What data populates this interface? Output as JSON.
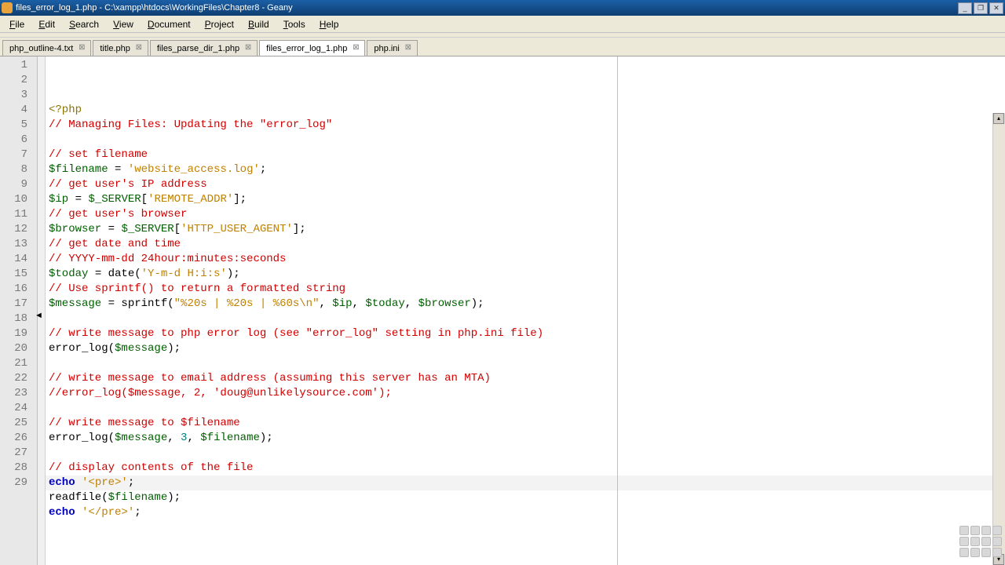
{
  "window": {
    "title": "files_error_log_1.php - C:\\xampp\\htdocs\\WorkingFiles\\Chapter8 - Geany"
  },
  "menu": {
    "file": "File",
    "edit": "Edit",
    "search": "Search",
    "view": "View",
    "document": "Document",
    "project": "Project",
    "build": "Build",
    "tools": "Tools",
    "help": "Help"
  },
  "tabs": [
    {
      "label": "php_outline-4.txt",
      "active": false
    },
    {
      "label": "title.php",
      "active": false
    },
    {
      "label": "files_parse_dir_1.php",
      "active": false
    },
    {
      "label": "files_error_log_1.php",
      "active": true
    },
    {
      "label": "php.ini",
      "active": false
    }
  ],
  "editor": {
    "line_count": 29,
    "current_line": 29,
    "tokens": [
      [
        {
          "t": "<?php",
          "c": "c-preproc"
        }
      ],
      [
        {
          "t": "// Managing Files: Updating the \"error_log\"",
          "c": "c-comment"
        }
      ],
      [],
      [
        {
          "t": "// set filename",
          "c": "c-comment"
        }
      ],
      [
        {
          "t": "$filename",
          "c": "c-var"
        },
        {
          "t": " = ",
          "c": "c-op"
        },
        {
          "t": "'website_access.log'",
          "c": "c-str"
        },
        {
          "t": ";",
          "c": "c-op"
        }
      ],
      [
        {
          "t": "// get user's IP address",
          "c": "c-comment"
        }
      ],
      [
        {
          "t": "$ip",
          "c": "c-var"
        },
        {
          "t": " = ",
          "c": "c-op"
        },
        {
          "t": "$_SERVER",
          "c": "c-var"
        },
        {
          "t": "[",
          "c": "c-op"
        },
        {
          "t": "'REMOTE_ADDR'",
          "c": "c-str"
        },
        {
          "t": "];",
          "c": "c-op"
        }
      ],
      [
        {
          "t": "// get user's browser",
          "c": "c-comment"
        }
      ],
      [
        {
          "t": "$browser",
          "c": "c-var"
        },
        {
          "t": " = ",
          "c": "c-op"
        },
        {
          "t": "$_SERVER",
          "c": "c-var"
        },
        {
          "t": "[",
          "c": "c-op"
        },
        {
          "t": "'HTTP_USER_AGENT'",
          "c": "c-str"
        },
        {
          "t": "];",
          "c": "c-op"
        }
      ],
      [
        {
          "t": "// get date and time",
          "c": "c-comment"
        }
      ],
      [
        {
          "t": "// YYYY-mm-dd 24hour:minutes:seconds",
          "c": "c-comment"
        }
      ],
      [
        {
          "t": "$today",
          "c": "c-var"
        },
        {
          "t": " = date(",
          "c": "c-op"
        },
        {
          "t": "'Y-m-d H:i:s'",
          "c": "c-str"
        },
        {
          "t": ");",
          "c": "c-op"
        }
      ],
      [
        {
          "t": "// Use sprintf() to return a formatted string",
          "c": "c-comment"
        }
      ],
      [
        {
          "t": "$message",
          "c": "c-var"
        },
        {
          "t": " = sprintf(",
          "c": "c-op"
        },
        {
          "t": "\"%20s | %20s | %60s\\n\"",
          "c": "c-str"
        },
        {
          "t": ", ",
          "c": "c-op"
        },
        {
          "t": "$ip",
          "c": "c-var"
        },
        {
          "t": ", ",
          "c": "c-op"
        },
        {
          "t": "$today",
          "c": "c-var"
        },
        {
          "t": ", ",
          "c": "c-op"
        },
        {
          "t": "$browser",
          "c": "c-var"
        },
        {
          "t": ");",
          "c": "c-op"
        }
      ],
      [],
      [
        {
          "t": "// write message to php error log (see \"error_log\" setting in php.ini file)",
          "c": "c-comment"
        }
      ],
      [
        {
          "t": "error_log(",
          "c": "c-func"
        },
        {
          "t": "$message",
          "c": "c-var"
        },
        {
          "t": ");",
          "c": "c-op"
        }
      ],
      [],
      [
        {
          "t": "// write message to email address (assuming this server has an MTA)",
          "c": "c-comment"
        }
      ],
      [
        {
          "t": "//error_log($message, 2, 'doug@unlikelysource.com');",
          "c": "c-comment"
        }
      ],
      [],
      [
        {
          "t": "// write message to $filename",
          "c": "c-comment"
        }
      ],
      [
        {
          "t": "error_log(",
          "c": "c-func"
        },
        {
          "t": "$message",
          "c": "c-var"
        },
        {
          "t": ", ",
          "c": "c-op"
        },
        {
          "t": "3",
          "c": "c-num"
        },
        {
          "t": ", ",
          "c": "c-op"
        },
        {
          "t": "$filename",
          "c": "c-var"
        },
        {
          "t": ");",
          "c": "c-op"
        }
      ],
      [],
      [
        {
          "t": "// display contents of the file",
          "c": "c-comment"
        }
      ],
      [
        {
          "t": "echo ",
          "c": "c-kw"
        },
        {
          "t": "'<pre>'",
          "c": "c-str"
        },
        {
          "t": ";",
          "c": "c-op"
        }
      ],
      [
        {
          "t": "readfile(",
          "c": "c-func"
        },
        {
          "t": "$filename",
          "c": "c-var"
        },
        {
          "t": ");",
          "c": "c-op"
        }
      ],
      [
        {
          "t": "echo ",
          "c": "c-kw"
        },
        {
          "t": "'</pre>'",
          "c": "c-str"
        },
        {
          "t": ";",
          "c": "c-op"
        }
      ],
      []
    ]
  }
}
